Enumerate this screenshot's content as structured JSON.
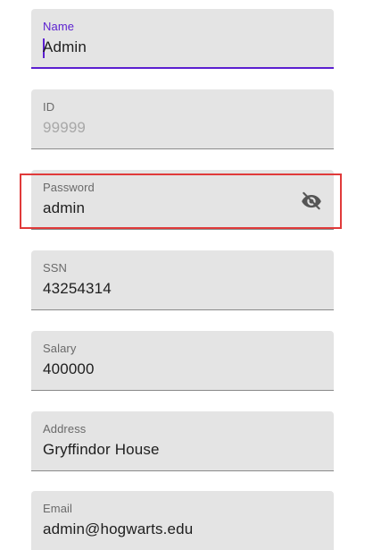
{
  "fields": [
    {
      "label": "Name",
      "value": "Admin"
    },
    {
      "label": "ID",
      "placeholder": "99999"
    },
    {
      "label": "Password",
      "value": "admin"
    },
    {
      "label": "SSN",
      "value": "43254314"
    },
    {
      "label": "Salary",
      "value": "400000"
    },
    {
      "label": "Address",
      "value": "Gryffindor House"
    },
    {
      "label": "Email",
      "value": "admin@hogwarts.edu"
    }
  ],
  "icons": {
    "password_toggle": "visibility-off-icon"
  },
  "colors": {
    "accent": "#5b1fd0",
    "field_bg": "#e4e4e4",
    "highlight": "#e03a3a"
  }
}
